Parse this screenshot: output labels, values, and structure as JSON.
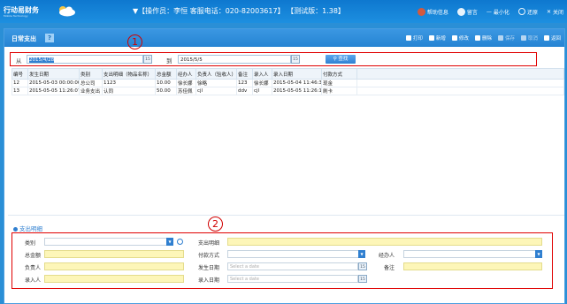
{
  "app": {
    "logo": "行动易财务",
    "logo_sub": "Mobile Technology",
    "operator_info": "▼【操作员：李恒  客服电话：020-82003617】  【测试版：1.38】",
    "top_actions": [
      "帮助信息",
      "留言",
      "最小化",
      "还原",
      "关闭"
    ]
  },
  "window": {
    "title": "日常支出",
    "help": "?",
    "toolbar": [
      {
        "label": "打印",
        "icon": "print-icon",
        "enabled": true
      },
      {
        "label": "新增",
        "icon": "add-icon",
        "enabled": true
      },
      {
        "label": "修改",
        "icon": "edit-icon",
        "enabled": true
      },
      {
        "label": "删除",
        "icon": "delete-icon",
        "enabled": true
      },
      {
        "label": "保存",
        "icon": "save-icon",
        "enabled": false
      },
      {
        "label": "取消",
        "icon": "cancel-icon",
        "enabled": false
      },
      {
        "label": "返回",
        "icon": "back-icon",
        "enabled": true
      }
    ]
  },
  "search": {
    "from_label": "从",
    "from_value": "2015/4/28",
    "to_label": "到",
    "to_value": "2015/5/5",
    "calendar_glyph": "15",
    "search_label": "查找",
    "search_icon": "magnifier-icon",
    "callout": "1"
  },
  "grid": {
    "columns": [
      "编号",
      "发生日期",
      "类别",
      "支出明细（物品名称）",
      "总金额",
      "经办人",
      "负责人（验收人）",
      "备注",
      "录入人",
      "录入日期",
      "付款方式"
    ],
    "rows": [
      [
        "12",
        "2015-05-03 00:00:00",
        "总公司",
        "1123",
        "10.00",
        "徐长娜",
        "徐略",
        "123",
        "徐长娜",
        "2015-05-04 11:46:34",
        "现金"
      ],
      [
        "13",
        "2015-05-05 11:26:07",
        "业务支出",
        "认同",
        "50.00",
        "苏佳佩",
        "cjl",
        "ddv",
        "cjl",
        "2015-05-05 11:26:15",
        "刷卡"
      ]
    ]
  },
  "detail": {
    "title": "支出明细",
    "callout": "2",
    "labels": {
      "category": "类别",
      "detail": "支出明细",
      "total": "总金额",
      "payment": "付款方式",
      "handler": "经办人",
      "owner": "负责人",
      "occur_date": "发生日期",
      "remark": "备注",
      "entry_person": "录入人",
      "entry_date": "录入日期"
    },
    "placeholders": {
      "occur_date": "Select a date",
      "entry_date": "Select a date"
    },
    "dropdown_glyph": "▼",
    "date_glyph": "15"
  },
  "colors": {
    "topbar": "#1d8fe0",
    "window_title": "#2584d3",
    "callout_border": "#e00000",
    "field_fill": "#fdf6b8",
    "accent": "#2f7fd0"
  }
}
